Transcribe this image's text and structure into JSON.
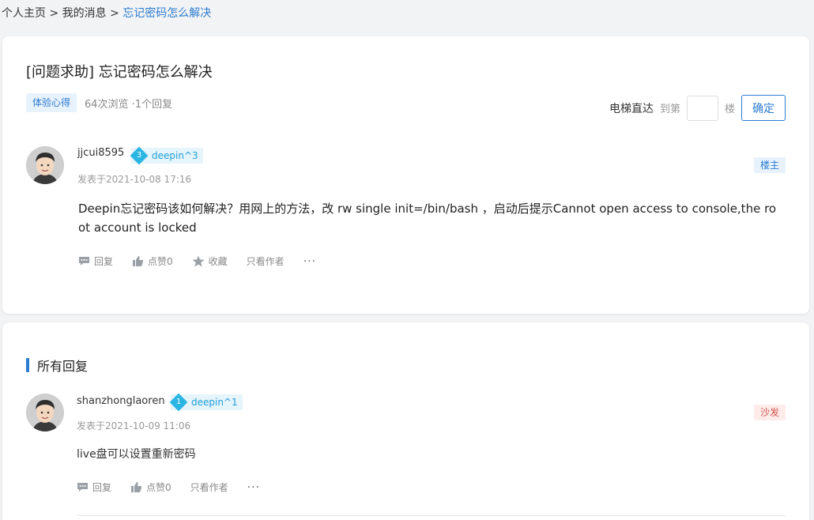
{
  "breadcrumb": {
    "items": [
      "个人主页",
      "我的消息"
    ],
    "separator": ">",
    "current": "忘记密码怎么解决"
  },
  "post": {
    "title": "[问题求助] 忘记密码怎么解决",
    "tag": "体验心得",
    "stats": "64次浏览 ·1个回复",
    "author": {
      "username": "jjcui8595",
      "level_num": "3",
      "level_name": "deepin^3",
      "date": "发表于2021-10-08 17:16",
      "badge": "楼主"
    },
    "content": "Deepin忘记密码该如何解决？用网上的方法，改 rw single init=/bin/bash ，启动后提示Cannot open access to console,the root account is locked",
    "actions": {
      "reply": "回复",
      "like": "点赞0",
      "favorite": "收藏",
      "author_only": "只看作者",
      "more": "···"
    }
  },
  "jump": {
    "label": "电梯直达",
    "prefix": "到第",
    "suffix": "楼",
    "floor_value": "",
    "confirm": "确定"
  },
  "replies": {
    "section_title": "所有回复",
    "items": [
      {
        "username": "shanzhonglaoren",
        "level_num": "1",
        "level_name": "deepin^1",
        "date": "发表于2021-10-09 11:06",
        "badge": "沙发",
        "content": "live盘可以设置重新密码",
        "actions": {
          "reply": "回复",
          "like": "点赞0",
          "author_only": "只看作者",
          "more": "···"
        }
      }
    ]
  },
  "colors": {
    "accent": "#2c7cd1",
    "level": "#2ab5e3",
    "sofa": "#d9534f"
  }
}
